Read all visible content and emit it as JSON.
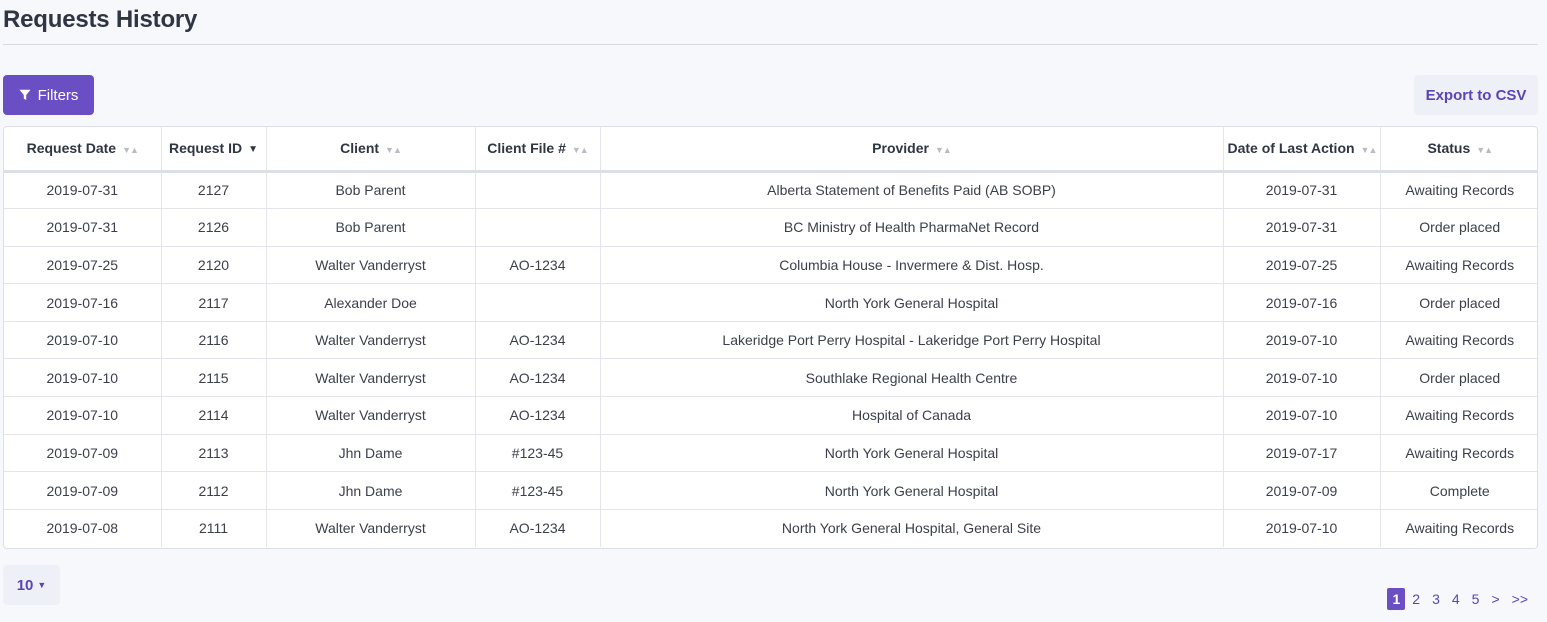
{
  "page": {
    "title": "Requests History"
  },
  "toolbar": {
    "filters_label": "Filters",
    "export_label": "Export to CSV"
  },
  "table": {
    "columns": [
      {
        "label": "Request Date",
        "sort": "none"
      },
      {
        "label": "Request ID",
        "sort": "desc"
      },
      {
        "label": "Client",
        "sort": "none"
      },
      {
        "label": "Client File #",
        "sort": "none"
      },
      {
        "label": "Provider",
        "sort": "none"
      },
      {
        "label": "Date of Last Action",
        "sort": "none"
      },
      {
        "label": "Status",
        "sort": "none"
      }
    ],
    "rows": [
      [
        "2019-07-31",
        "2127",
        "Bob Parent",
        "",
        "Alberta Statement of Benefits Paid (AB SOBP)",
        "2019-07-31",
        "Awaiting Records"
      ],
      [
        "2019-07-31",
        "2126",
        "Bob Parent",
        "",
        "BC Ministry of Health PharmaNet Record",
        "2019-07-31",
        "Order placed"
      ],
      [
        "2019-07-25",
        "2120",
        "Walter Vanderryst",
        "AO-1234",
        "Columbia House - Invermere & Dist. Hosp.",
        "2019-07-25",
        "Awaiting Records"
      ],
      [
        "2019-07-16",
        "2117",
        "Alexander Doe",
        "",
        "North York General Hospital",
        "2019-07-16",
        "Order placed"
      ],
      [
        "2019-07-10",
        "2116",
        "Walter Vanderryst",
        "AO-1234",
        "Lakeridge Port Perry Hospital - Lakeridge Port Perry Hospital",
        "2019-07-10",
        "Awaiting Records"
      ],
      [
        "2019-07-10",
        "2115",
        "Walter Vanderryst",
        "AO-1234",
        "Southlake Regional Health Centre",
        "2019-07-10",
        "Order placed"
      ],
      [
        "2019-07-10",
        "2114",
        "Walter Vanderryst",
        "AO-1234",
        "Hospital of Canada",
        "2019-07-10",
        "Awaiting Records"
      ],
      [
        "2019-07-09",
        "2113",
        "Jhn Dame",
        "#123-45",
        "North York General Hospital",
        "2019-07-17",
        "Awaiting Records"
      ],
      [
        "2019-07-09",
        "2112",
        "Jhn Dame",
        "#123-45",
        "North York General Hospital",
        "2019-07-09",
        "Complete"
      ],
      [
        "2019-07-08",
        "2111",
        "Walter Vanderryst",
        "AO-1234",
        "North York General Hospital, General Site",
        "2019-07-10",
        "Awaiting Records"
      ]
    ]
  },
  "pagination": {
    "page_size": "10",
    "pages": [
      "1",
      "2",
      "3",
      "4",
      "5"
    ],
    "current": "1",
    "next": ">",
    "last": ">>"
  },
  "colors": {
    "accent": "#6a4fc4",
    "accent_text": "#5a44b8"
  },
  "icons": {
    "filters": "filter-icon",
    "sort_none": "sort-icon",
    "sort_desc": "sort-desc-icon"
  }
}
